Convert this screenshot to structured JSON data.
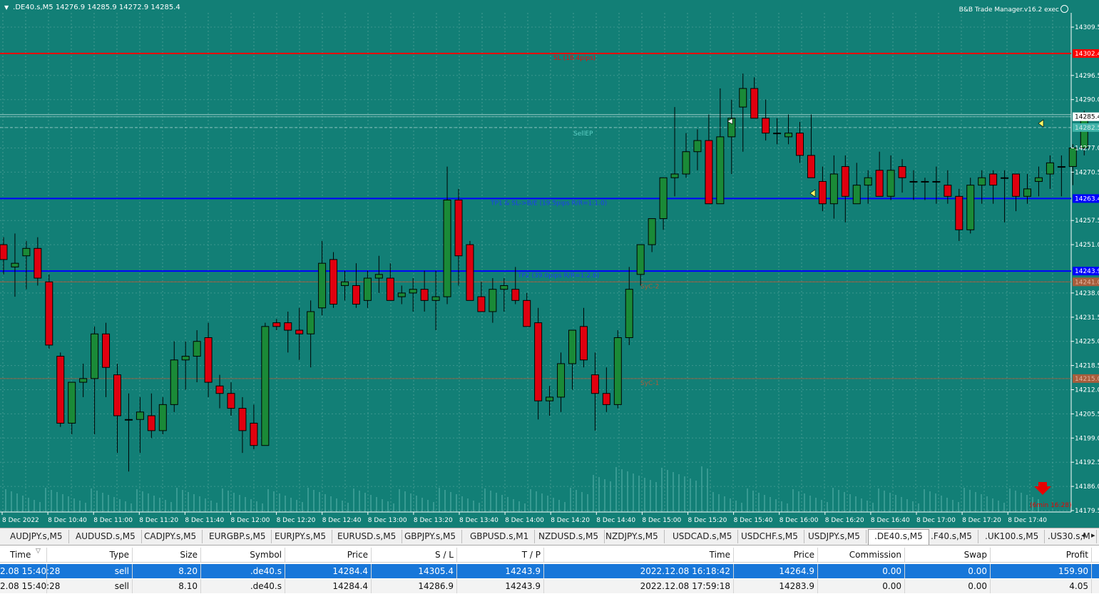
{
  "chart": {
    "symbol_header": ".DE40.s,M5  14276.9 14285.9 14272.9 14285.4",
    "ea_label": "B&B Trade Manager.v16.2 exec",
    "colors": {
      "background": "#127f76",
      "bull": "#1a8a37",
      "bear": "#e0000f",
      "grid": "#6fb3ac",
      "sl_line": "#ff0000",
      "tp_line": "#0000ff",
      "bid_line": "#cfe8e5",
      "level_brown": "#a65d3c"
    },
    "price_axis": [
      "14309.5",
      "14302.4",
      "14296.5",
      "14290.0",
      "14285.4",
      "14282.5",
      "14277.0",
      "14270.5",
      "14263.4",
      "14257.5",
      "14251.0",
      "14243.9",
      "14241.0",
      "14238.0",
      "14231.5",
      "14225.0",
      "14218.5",
      "14215.0",
      "14212.0",
      "14205.5",
      "14199.0",
      "14192.5",
      "14186.0",
      "14179.5"
    ],
    "time_axis": [
      "8 Dec 2022",
      "8 Dec 10:40",
      "8 Dec 11:00",
      "8 Dec 11:20",
      "8 Dec 11:40",
      "8 Dec 12:00",
      "8 Dec 12:20",
      "8 Dec 12:40",
      "8 Dec 13:00",
      "8 Dec 13:20",
      "8 Dec 13:40",
      "8 Dec 14:00",
      "8 Dec 14:20",
      "8 Dec 14:40",
      "8 Dec 15:00",
      "8 Dec 15:20",
      "8 Dec 15:40",
      "8 Dec 16:00",
      "8 Dec 16:20",
      "8 Dec 16:40",
      "8 Dec 17:00",
      "8 Dec 17:20",
      "8 Dec 17:40"
    ],
    "level_labels": {
      "sl": "SL (18.4pips)",
      "sellep": "SellEP",
      "tp1": "TP1 & SL->B/E (19.5pips R/R=1:1.0)",
      "tp2": "TP2 (39.0pips R/R=1:2.0)",
      "lvl1": "SyC-2",
      "lvl2": "SyC-1"
    },
    "price_tags": {
      "sl": "14302.4",
      "bid": "14285.4",
      "ask": "14282.5",
      "tp1": "14263.4",
      "tp2": "14243.9",
      "lvl1": "14241.0",
      "lvl2": "14215.0"
    },
    "timer_label": "(6min 16:28)",
    "candles": [
      {
        "o": 14251,
        "h": 14253,
        "l": 14243,
        "c": 14247
      },
      {
        "o": 14245,
        "h": 14254,
        "l": 14237,
        "c": 14246
      },
      {
        "o": 14248,
        "h": 14252,
        "l": 14239,
        "c": 14250
      },
      {
        "o": 14250,
        "h": 14253,
        "l": 14240,
        "c": 14242
      },
      {
        "o": 14241,
        "h": 14243,
        "l": 14223,
        "c": 14224
      },
      {
        "o": 14221,
        "h": 14222,
        "l": 14202,
        "c": 14203
      },
      {
        "o": 14203,
        "h": 14214,
        "l": 14200,
        "c": 14214
      },
      {
        "o": 14214,
        "h": 14219,
        "l": 14210,
        "c": 14215
      },
      {
        "o": 14215,
        "h": 14229,
        "l": 14200,
        "c": 14227
      },
      {
        "o": 14227,
        "h": 14230,
        "l": 14210,
        "c": 14218
      },
      {
        "o": 14216,
        "h": 14219,
        "l": 14195,
        "c": 14205
      },
      {
        "o": 14204,
        "h": 14211,
        "l": 14190,
        "c": 14204
      },
      {
        "o": 14204,
        "h": 14210,
        "l": 14195,
        "c": 14206
      },
      {
        "o": 14205,
        "h": 14211,
        "l": 14199,
        "c": 14201
      },
      {
        "o": 14201,
        "h": 14210,
        "l": 14200,
        "c": 14208
      },
      {
        "o": 14208,
        "h": 14225,
        "l": 14206,
        "c": 14220
      },
      {
        "o": 14220,
        "h": 14225,
        "l": 14212,
        "c": 14221
      },
      {
        "o": 14221,
        "h": 14228,
        "l": 14214,
        "c": 14225
      },
      {
        "o": 14226,
        "h": 14230,
        "l": 14210,
        "c": 14214
      },
      {
        "o": 14213,
        "h": 14216,
        "l": 14207,
        "c": 14211
      },
      {
        "o": 14211,
        "h": 14214,
        "l": 14205,
        "c": 14207
      },
      {
        "o": 14207,
        "h": 14210,
        "l": 14195,
        "c": 14201
      },
      {
        "o": 14203,
        "h": 14208,
        "l": 14196,
        "c": 14197
      },
      {
        "o": 14197,
        "h": 14230,
        "l": 14197,
        "c": 14229
      },
      {
        "o": 14230,
        "h": 14231,
        "l": 14228,
        "c": 14229
      },
      {
        "o": 14230,
        "h": 14233,
        "l": 14222,
        "c": 14228
      },
      {
        "o": 14228,
        "h": 14234,
        "l": 14220,
        "c": 14227
      },
      {
        "o": 14227,
        "h": 14236,
        "l": 14218,
        "c": 14233
      },
      {
        "o": 14234,
        "h": 14252,
        "l": 14232,
        "c": 14246
      },
      {
        "o": 14247,
        "h": 14249,
        "l": 14234,
        "c": 14235
      },
      {
        "o": 14240,
        "h": 14244,
        "l": 14236,
        "c": 14241
      },
      {
        "o": 14240,
        "h": 14246,
        "l": 14234,
        "c": 14235
      },
      {
        "o": 14236,
        "h": 14244,
        "l": 14234,
        "c": 14242
      },
      {
        "o": 14242,
        "h": 14248,
        "l": 14238,
        "c": 14243
      },
      {
        "o": 14242,
        "h": 14246,
        "l": 14236,
        "c": 14236
      },
      {
        "o": 14237,
        "h": 14240,
        "l": 14235,
        "c": 14238
      },
      {
        "o": 14238,
        "h": 14242,
        "l": 14233,
        "c": 14239
      },
      {
        "o": 14239,
        "h": 14244,
        "l": 14233,
        "c": 14236
      },
      {
        "o": 14236,
        "h": 14244,
        "l": 14228,
        "c": 14237
      },
      {
        "o": 14237,
        "h": 14272,
        "l": 14235,
        "c": 14263
      },
      {
        "o": 14263,
        "h": 14266,
        "l": 14240,
        "c": 14248
      },
      {
        "o": 14251,
        "h": 14252,
        "l": 14237,
        "c": 14236
      },
      {
        "o": 14237,
        "h": 14241,
        "l": 14233,
        "c": 14233
      },
      {
        "o": 14233,
        "h": 14242,
        "l": 14230,
        "c": 14239
      },
      {
        "o": 14239,
        "h": 14242,
        "l": 14233,
        "c": 14240
      },
      {
        "o": 14239,
        "h": 14245,
        "l": 14235,
        "c": 14236
      },
      {
        "o": 14236,
        "h": 14238,
        "l": 14229,
        "c": 14229
      },
      {
        "o": 14230,
        "h": 14234,
        "l": 14204,
        "c": 14209
      },
      {
        "o": 14209,
        "h": 14213,
        "l": 14205,
        "c": 14210
      },
      {
        "o": 14210,
        "h": 14222,
        "l": 14206,
        "c": 14219
      },
      {
        "o": 14219,
        "h": 14225,
        "l": 14212,
        "c": 14228
      },
      {
        "o": 14229,
        "h": 14234,
        "l": 14218,
        "c": 14220
      },
      {
        "o": 14216,
        "h": 14222,
        "l": 14201,
        "c": 14211
      },
      {
        "o": 14211,
        "h": 14218,
        "l": 14206,
        "c": 14208
      },
      {
        "o": 14208,
        "h": 14228,
        "l": 14207,
        "c": 14226
      },
      {
        "o": 14226,
        "h": 14245,
        "l": 14224,
        "c": 14239
      },
      {
        "o": 14243,
        "h": 14251,
        "l": 14240,
        "c": 14251
      },
      {
        "o": 14251,
        "h": 14258,
        "l": 14249,
        "c": 14258
      },
      {
        "o": 14258,
        "h": 14266,
        "l": 14255,
        "c": 14269
      },
      {
        "o": 14269,
        "h": 14288,
        "l": 14264,
        "c": 14270
      },
      {
        "o": 14270,
        "h": 14281,
        "l": 14269,
        "c": 14276
      },
      {
        "o": 14276,
        "h": 14282,
        "l": 14271,
        "c": 14279
      },
      {
        "o": 14279,
        "h": 14286,
        "l": 14262,
        "c": 14262
      },
      {
        "o": 14262,
        "h": 14293,
        "l": 14262,
        "c": 14280
      },
      {
        "o": 14280,
        "h": 14290,
        "l": 14270,
        "c": 14285
      },
      {
        "o": 14288,
        "h": 14297,
        "l": 14276,
        "c": 14293
      },
      {
        "o": 14293,
        "h": 14296,
        "l": 14285,
        "c": 14285
      },
      {
        "o": 14285,
        "h": 14290,
        "l": 14279,
        "c": 14281
      },
      {
        "o": 14281,
        "h": 14285,
        "l": 14278,
        "c": 14281
      },
      {
        "o": 14280,
        "h": 14286,
        "l": 14278,
        "c": 14281
      },
      {
        "o": 14281,
        "h": 14284,
        "l": 14273,
        "c": 14275
      },
      {
        "o": 14275,
        "h": 14286,
        "l": 14270,
        "c": 14269
      },
      {
        "o": 14268,
        "h": 14272,
        "l": 14260,
        "c": 14262
      },
      {
        "o": 14262,
        "h": 14275,
        "l": 14258,
        "c": 14270
      },
      {
        "o": 14272,
        "h": 14275,
        "l": 14257,
        "c": 14264
      },
      {
        "o": 14262,
        "h": 14273,
        "l": 14262,
        "c": 14267
      },
      {
        "o": 14267,
        "h": 14271,
        "l": 14262,
        "c": 14269
      },
      {
        "o": 14271,
        "h": 14276,
        "l": 14264,
        "c": 14264
      },
      {
        "o": 14264,
        "h": 14275,
        "l": 14263,
        "c": 14271
      },
      {
        "o": 14272,
        "h": 14274,
        "l": 14265,
        "c": 14269
      },
      {
        "o": 14268,
        "h": 14271,
        "l": 14263,
        "c": 14268
      },
      {
        "o": 14268,
        "h": 14269,
        "l": 14263,
        "c": 14268
      },
      {
        "o": 14268,
        "h": 14272,
        "l": 14262,
        "c": 14268
      },
      {
        "o": 14267,
        "h": 14271,
        "l": 14262,
        "c": 14264
      },
      {
        "o": 14264,
        "h": 14266,
        "l": 14252,
        "c": 14255
      },
      {
        "o": 14255,
        "h": 14269,
        "l": 14254,
        "c": 14267
      },
      {
        "o": 14267,
        "h": 14271,
        "l": 14262,
        "c": 14269
      },
      {
        "o": 14270,
        "h": 14271,
        "l": 14262,
        "c": 14267
      },
      {
        "o": 14269,
        "h": 14271,
        "l": 14257,
        "c": 14269
      },
      {
        "o": 14270,
        "h": 14270,
        "l": 14260,
        "c": 14264
      },
      {
        "o": 14264,
        "h": 14270,
        "l": 14262,
        "c": 14266
      },
      {
        "o": 14268,
        "h": 14272,
        "l": 14264,
        "c": 14269
      },
      {
        "o": 14270,
        "h": 14275,
        "l": 14266,
        "c": 14273
      },
      {
        "o": 14272,
        "h": 14275,
        "l": 14264,
        "c": 14272
      },
      {
        "o": 14272,
        "h": 14278,
        "l": 14267,
        "c": 14277
      },
      {
        "o": 14277,
        "h": 14287,
        "l": 14275,
        "c": 14285
      }
    ]
  },
  "tabs": [
    "AUDJPY.s,M5",
    "AUDUSD.s,M5",
    "CADJPY.s,M5",
    "EURGBP.s,M5",
    "EURJPY.s,M5",
    "EURUSD.s,M5",
    "GBPJPY.s,M5",
    "GBPUSD.s,M1",
    "NZDUSD.s,M5",
    "NZDJPY.s,M5",
    "USDCAD.s,M5",
    "USDCHF.s,M5",
    "USDJPY.s,M5",
    ".DE40.s,M5",
    ".F40.s,M5",
    ".UK100.s,M5",
    ".US30.s,M"
  ],
  "active_tab": ".DE40.s,M5",
  "tab_nav": {
    "left": "◂",
    "right": "▸"
  },
  "table": {
    "columns": [
      "Time",
      "Type",
      "Size",
      "Symbol",
      "Price",
      "S / L",
      "T / P",
      "Time",
      "Price",
      "Commission",
      "Swap",
      "Profit"
    ],
    "sort_indicator": "▽",
    "rows": [
      [
        "2.08 15:40:28",
        "sell",
        "8.20",
        ".de40.s",
        "14284.4",
        "14305.4",
        "14243.9",
        "2022.12.08 16:18:42",
        "14264.9",
        "0.00",
        "0.00",
        "159.90"
      ],
      [
        "2.08 15:40:28",
        "sell",
        "8.10",
        ".de40.s",
        "14284.4",
        "14286.9",
        "14243.9",
        "2022.12.08 17:59:18",
        "14283.9",
        "0.00",
        "0.00",
        "4.05"
      ]
    ]
  }
}
